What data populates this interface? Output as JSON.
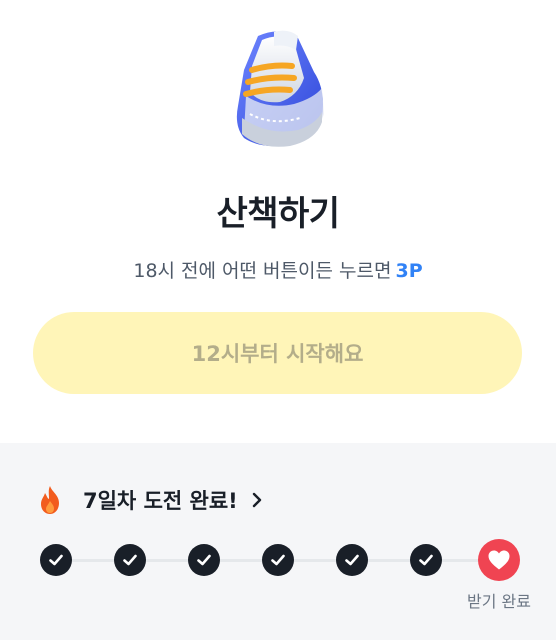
{
  "mission": {
    "icon": "sneaker-icon",
    "title": "산책하기",
    "condition_text": "18시 전에 어떤 버튼이든 누르면",
    "reward_points": "3P",
    "start_button_label": "12시부터 시작해요"
  },
  "streak": {
    "icon": "fire-icon",
    "title": "7일차 도전 완료!",
    "days": [
      {
        "status": "completed",
        "icon": "check-icon"
      },
      {
        "status": "completed",
        "icon": "check-icon"
      },
      {
        "status": "completed",
        "icon": "check-icon"
      },
      {
        "status": "completed",
        "icon": "check-icon"
      },
      {
        "status": "completed",
        "icon": "check-icon"
      },
      {
        "status": "completed",
        "icon": "check-icon"
      },
      {
        "status": "reward",
        "icon": "heart-icon"
      }
    ],
    "reward_label": "받기 완료"
  },
  "colors": {
    "accent_blue": "#3182f6",
    "button_bg": "#fff5b8",
    "reward_red": "#f04452",
    "day_dot": "#191f28"
  }
}
